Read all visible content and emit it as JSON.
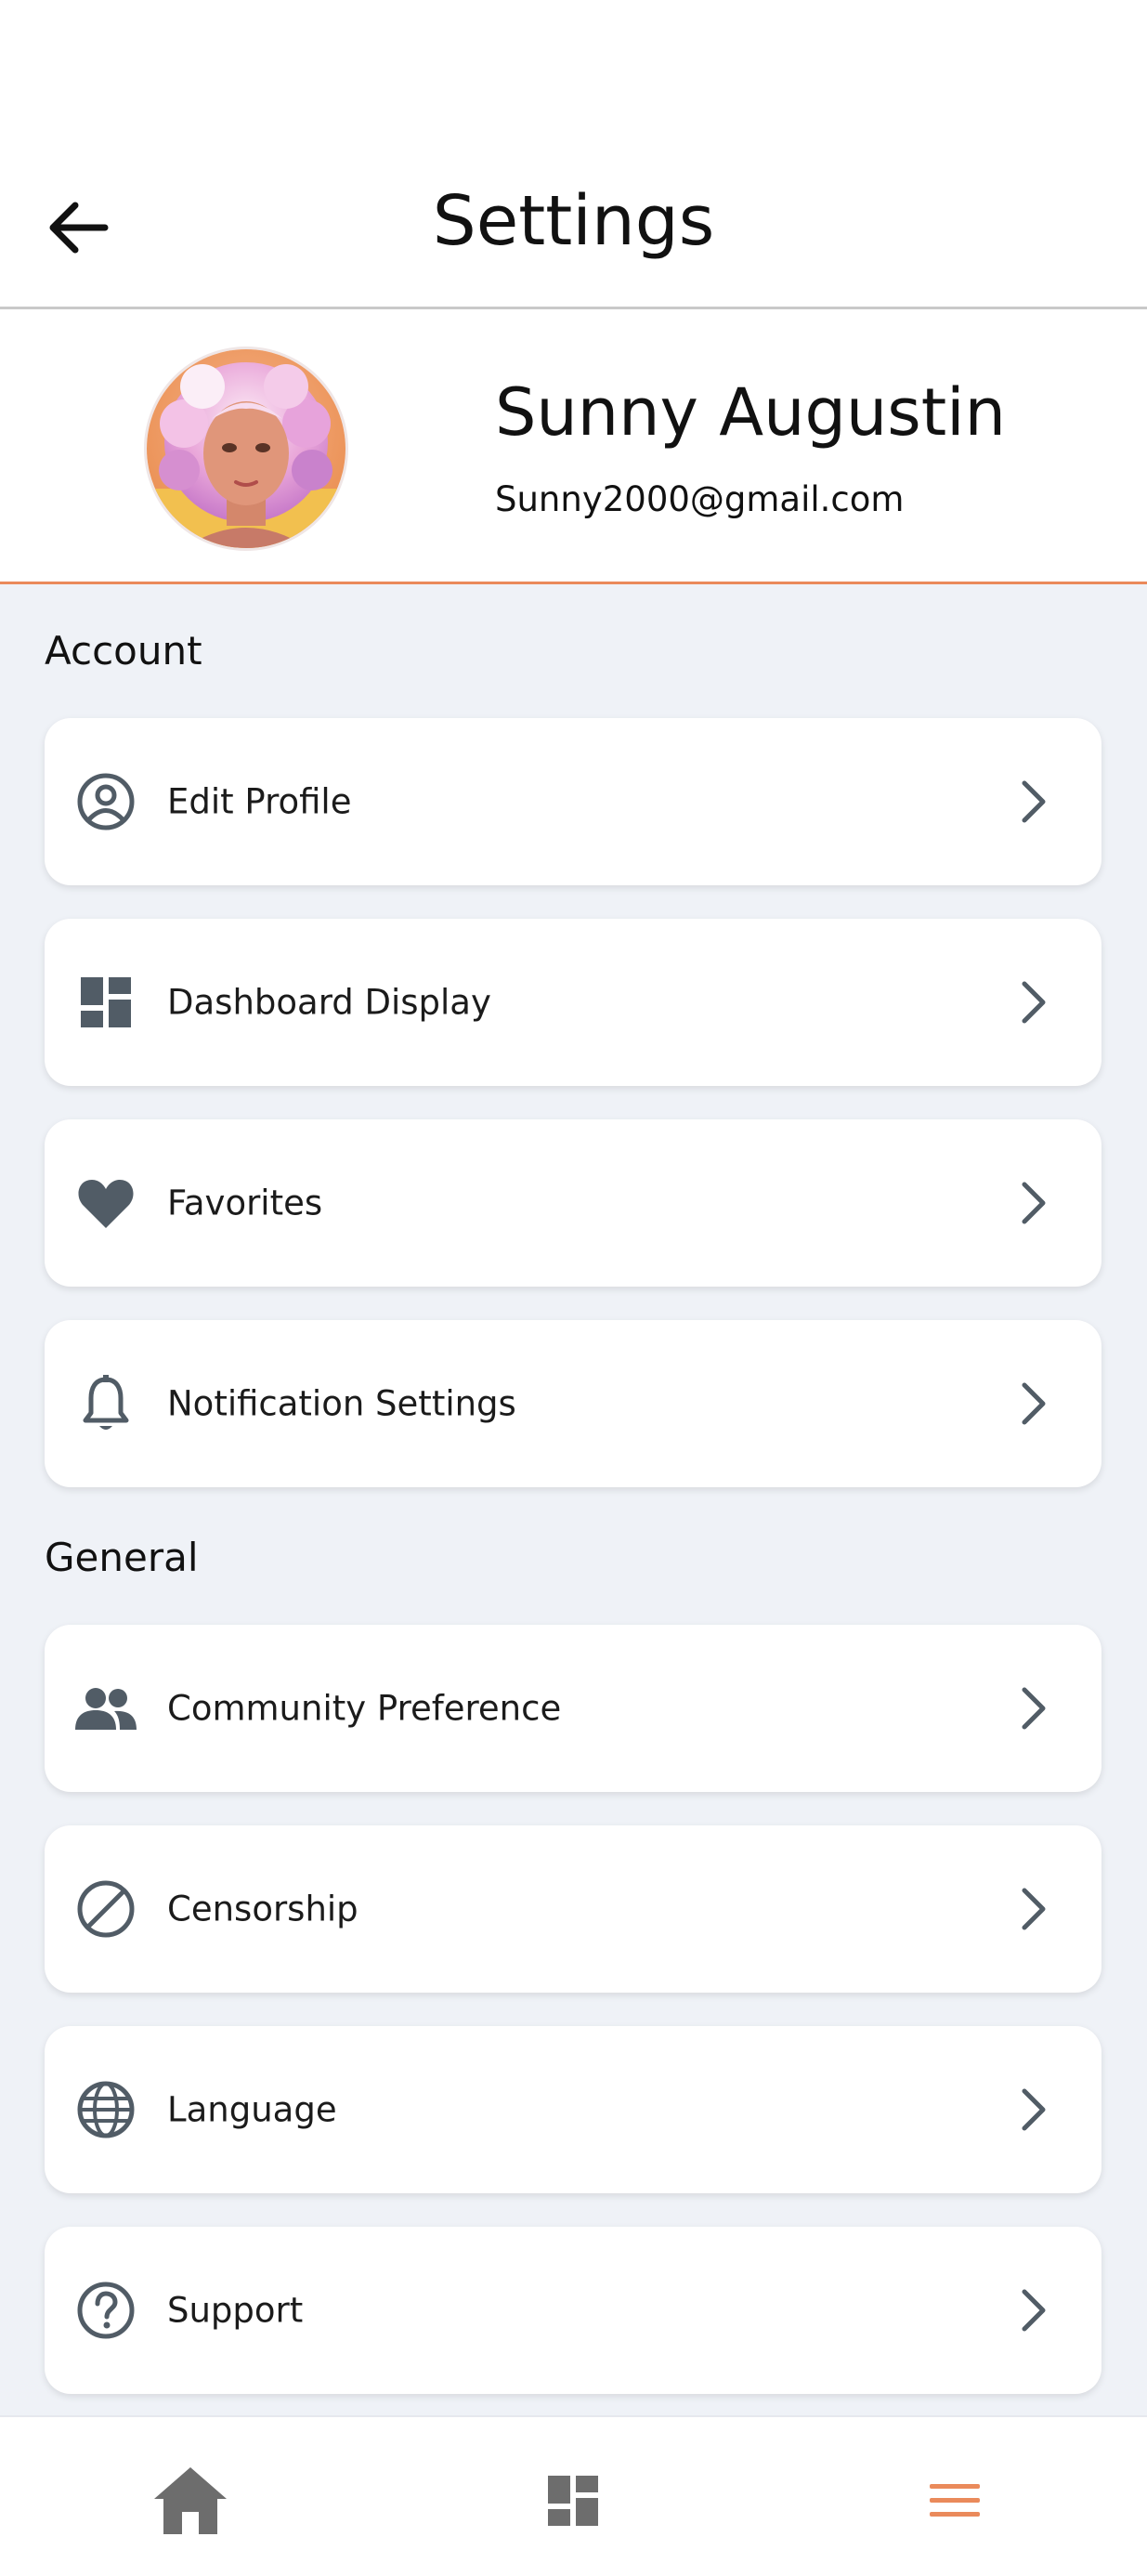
{
  "header": {
    "title": "Settings"
  },
  "profile": {
    "name": "Sunny Augustin",
    "email": "Sunny2000@gmail.com"
  },
  "sections": {
    "account": {
      "title": "Account",
      "items": [
        {
          "label": "Edit Profile",
          "icon": "account-circle-icon"
        },
        {
          "label": "Dashboard Display",
          "icon": "dashboard-icon"
        },
        {
          "label": "Favorites",
          "icon": "heart-icon"
        },
        {
          "label": "Notification Settings",
          "icon": "bell-icon"
        }
      ]
    },
    "general": {
      "title": "General",
      "items": [
        {
          "label": "Community Preference",
          "icon": "people-icon"
        },
        {
          "label": "Censorship",
          "icon": "block-icon"
        },
        {
          "label": "Language",
          "icon": "globe-icon"
        },
        {
          "label": "Support",
          "icon": "help-icon"
        }
      ]
    }
  },
  "bottom_nav": {
    "items": [
      {
        "icon": "home-icon",
        "active": false
      },
      {
        "icon": "dashboard-icon",
        "active": false
      },
      {
        "icon": "menu-icon",
        "active": true
      }
    ]
  },
  "colors": {
    "accent": "#ea8a5b",
    "icon": "#515c66",
    "nav_inactive": "#6d6d6d",
    "background": "#eff2f7"
  }
}
